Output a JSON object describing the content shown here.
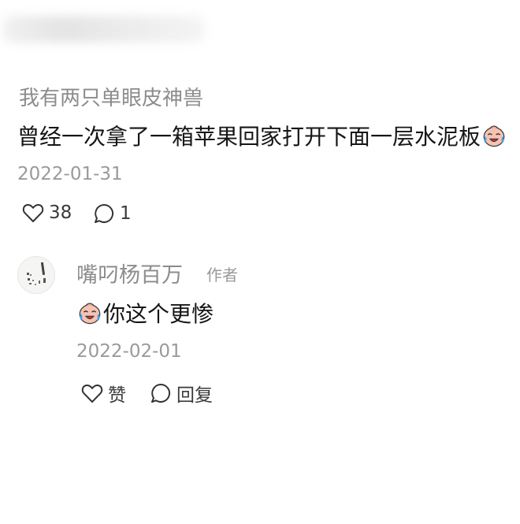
{
  "comment": {
    "username": "我有两只单眼皮神兽",
    "text": "曾经一次拿了一箱苹果回家打开下面一层水泥板",
    "emoji": "crying-laughing-emoji",
    "date": "2022-01-31",
    "likes": "38",
    "replies_count": "1"
  },
  "reply": {
    "username": "嘴叼杨百万",
    "author_tag": "作者",
    "emoji": "crying-laughing-emoji",
    "text": "你这个更惨",
    "date": "2022-02-01",
    "like_label": "赞",
    "reply_label": "回复"
  },
  "colors": {
    "background": "#ffffff",
    "primary_text": "#161616",
    "secondary_text": "#8c8c8c",
    "emoji_face": "#f6c2b4",
    "emoji_tear": "#3fa0ee"
  }
}
